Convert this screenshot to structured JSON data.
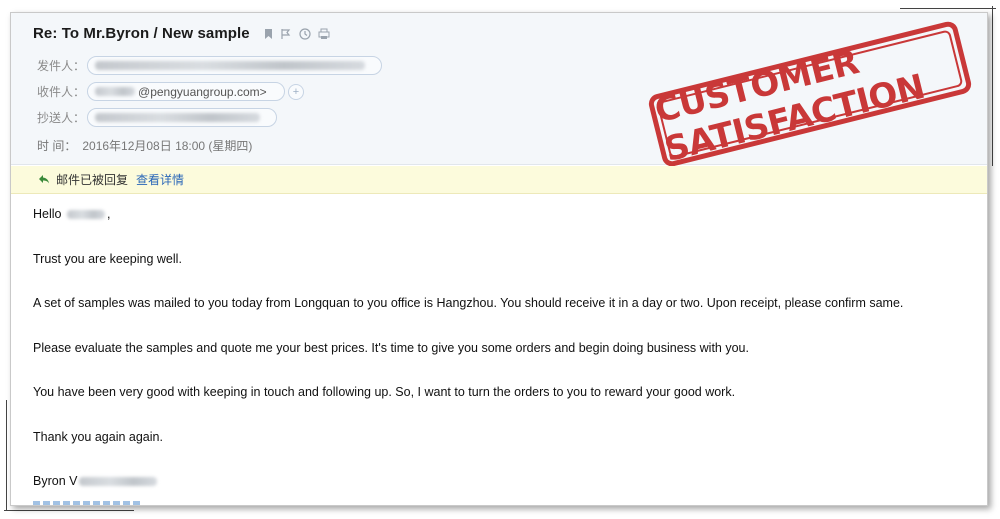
{
  "email": {
    "subject": "Re: To Mr.Byron / New sample",
    "from_label": "发件人：",
    "to_label": "收件人：",
    "to_domain": "@pengyuangroup.com>",
    "cc_label": "抄送人：",
    "time_label": "时  间：",
    "time_value": "2016年12月08日 18:00 (星期四)",
    "add_symbol": "+"
  },
  "replied_bar": {
    "status": "邮件已被回复",
    "detail_link": "查看详情"
  },
  "stamp": {
    "text": "CUSTOMER SATISFACTION",
    "color": "#c62828"
  },
  "body": {
    "greeting_prefix": "Hello",
    "greeting_suffix": ",",
    "p1": "Trust you are keeping well.",
    "p2": "A set of samples was mailed to you today from Longquan to you office is Hangzhou. You should receive it in a day or two. Upon receipt, please confirm same.",
    "p3": "Please evaluate the samples and quote me your best prices. It's time to give you some orders and begin doing business with you.",
    "p4": "You have been very good with keeping in touch and following up.  So, I want to turn the orders to you to reward your good work.",
    "p5": "Thank you again again.",
    "signature_prefix": "Byron V"
  },
  "icons": [
    "bookmark-icon",
    "flag-icon",
    "clock-icon",
    "print-icon",
    "reply-arrow-icon"
  ]
}
